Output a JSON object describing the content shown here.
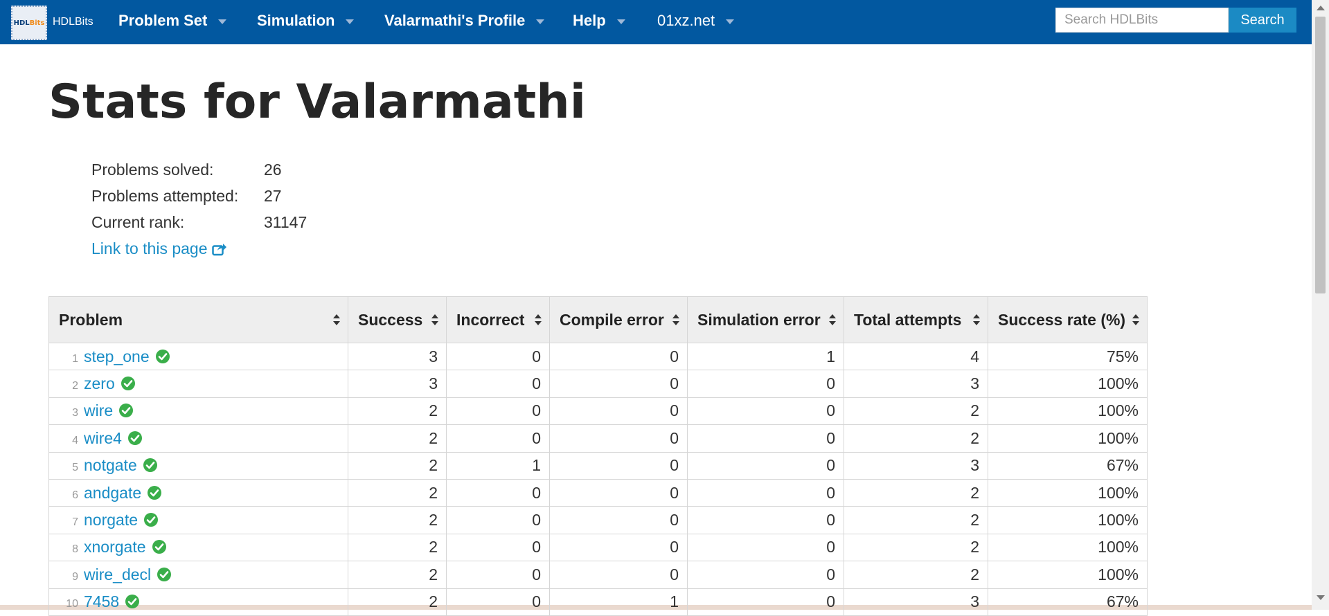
{
  "nav": {
    "logo_text_a": "HDL",
    "logo_text_b": "Bits",
    "brand": "HDLBits",
    "items": [
      {
        "label": "Problem Set"
      },
      {
        "label": "Simulation"
      },
      {
        "label": "Valarmathi's Profile"
      },
      {
        "label": "Help"
      },
      {
        "label": "01xz.net"
      }
    ],
    "search_placeholder": "Search HDLBits",
    "search_button": "Search"
  },
  "page": {
    "title": "Stats for Valarmathi",
    "stats": [
      {
        "label": "Problems solved:",
        "value": "26"
      },
      {
        "label": "Problems attempted:",
        "value": "27"
      },
      {
        "label": "Current rank:",
        "value": "31147"
      }
    ],
    "permalink": "Link to this page"
  },
  "table": {
    "headers": [
      "Problem",
      "Success",
      "Incorrect",
      "Compile error",
      "Simulation error",
      "Total attempts",
      "Success rate (%)"
    ],
    "rows": [
      {
        "n": "1",
        "problem": "step_one",
        "success": "3",
        "incorrect": "0",
        "compile": "0",
        "simulation": "1",
        "total": "4",
        "rate": "75%"
      },
      {
        "n": "2",
        "problem": "zero",
        "success": "3",
        "incorrect": "0",
        "compile": "0",
        "simulation": "0",
        "total": "3",
        "rate": "100%"
      },
      {
        "n": "3",
        "problem": "wire",
        "success": "2",
        "incorrect": "0",
        "compile": "0",
        "simulation": "0",
        "total": "2",
        "rate": "100%"
      },
      {
        "n": "4",
        "problem": "wire4",
        "success": "2",
        "incorrect": "0",
        "compile": "0",
        "simulation": "0",
        "total": "2",
        "rate": "100%"
      },
      {
        "n": "5",
        "problem": "notgate",
        "success": "2",
        "incorrect": "1",
        "compile": "0",
        "simulation": "0",
        "total": "3",
        "rate": "67%"
      },
      {
        "n": "6",
        "problem": "andgate",
        "success": "2",
        "incorrect": "0",
        "compile": "0",
        "simulation": "0",
        "total": "2",
        "rate": "100%"
      },
      {
        "n": "7",
        "problem": "norgate",
        "success": "2",
        "incorrect": "0",
        "compile": "0",
        "simulation": "0",
        "total": "2",
        "rate": "100%"
      },
      {
        "n": "8",
        "problem": "xnorgate",
        "success": "2",
        "incorrect": "0",
        "compile": "0",
        "simulation": "0",
        "total": "2",
        "rate": "100%"
      },
      {
        "n": "9",
        "problem": "wire_decl",
        "success": "2",
        "incorrect": "0",
        "compile": "0",
        "simulation": "0",
        "total": "2",
        "rate": "100%"
      },
      {
        "n": "10",
        "problem": "7458",
        "success": "2",
        "incorrect": "0",
        "compile": "1",
        "simulation": "0",
        "total": "3",
        "rate": "67%"
      }
    ]
  },
  "colors": {
    "navbar": "#0258a0",
    "link": "#1a8dc6",
    "success_check": "#3aae4a"
  }
}
